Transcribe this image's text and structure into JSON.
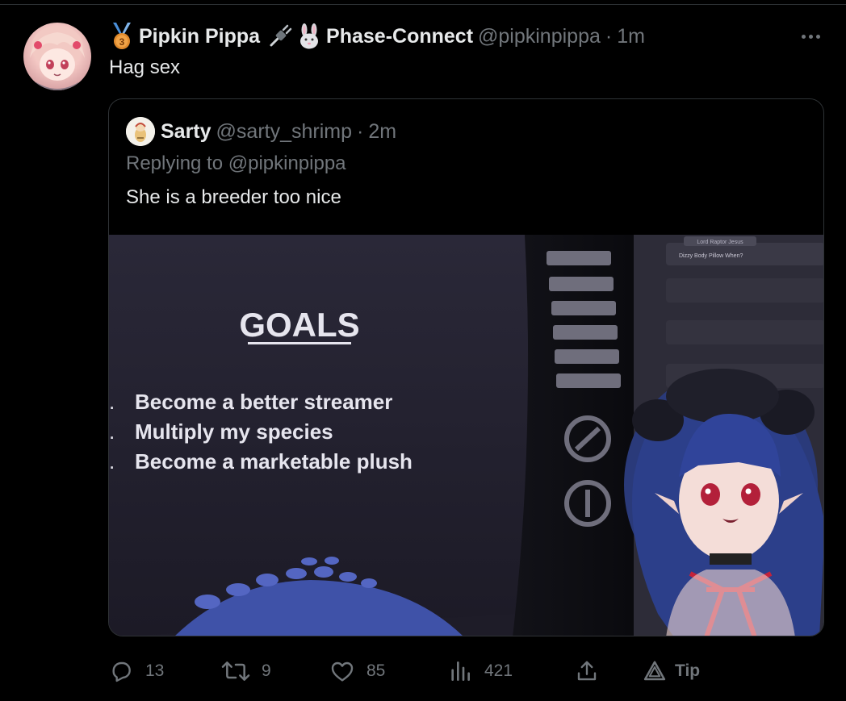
{
  "tweet": {
    "display_name": "Pipkin Pippa",
    "affiliate_name": "Phase-Connect",
    "handle": "@pipkinpippa",
    "separator": "·",
    "time": "1m",
    "text": "Hag sex",
    "badge_number": "3"
  },
  "quote": {
    "display_name": "Sarty",
    "handle": "@sarty_shrimp",
    "separator": "·",
    "time": "2m",
    "replying_to": "Replying to @pipkinpippa",
    "text": "She is a breeder too nice",
    "media": {
      "slide_title": "GOALS",
      "bullets": [
        "Become a better streamer",
        "Multiply my species",
        "Become a marketable plush"
      ],
      "chat_author": "Lord Raptor Jesus",
      "chat_message": "Dizzy Body Pillow When?"
    }
  },
  "actions": {
    "replies": "13",
    "retweets": "9",
    "likes": "85",
    "views": "421",
    "tip_label": "Tip"
  },
  "colors": {
    "background": "#000000",
    "text": "#e7e9ea",
    "muted": "#71767b",
    "border": "#2f3336",
    "badge_gold": "#e08a2c",
    "badge_ribbon": "#4a8fd9"
  }
}
